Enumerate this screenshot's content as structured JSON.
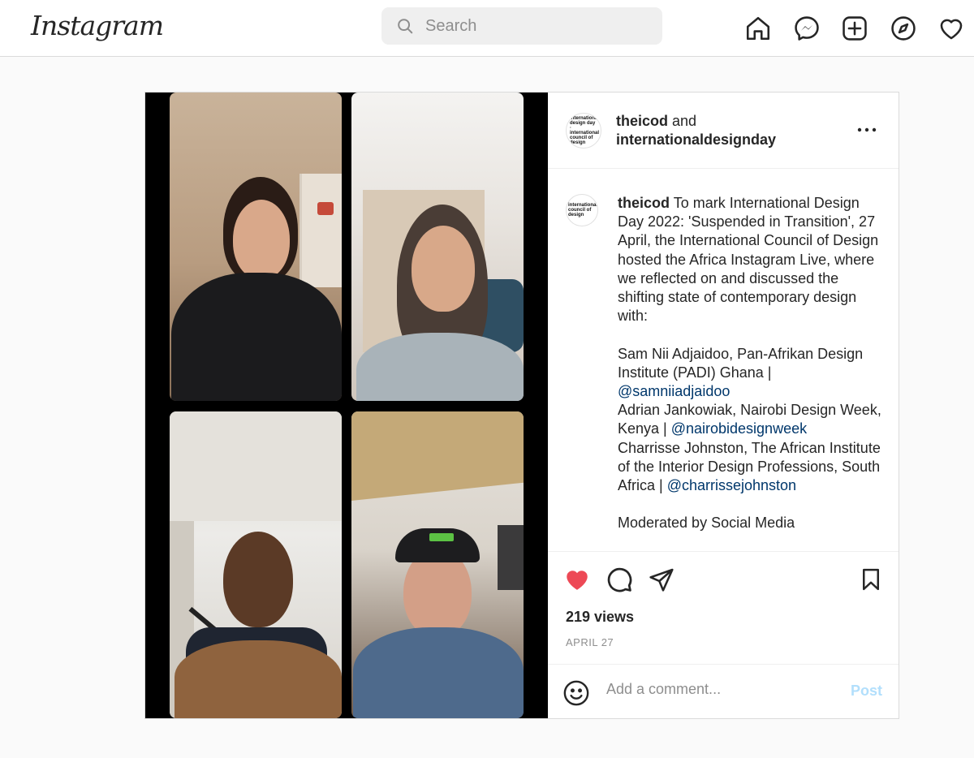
{
  "app": {
    "logo_text": "Instagram"
  },
  "search": {
    "placeholder": "Search",
    "value": ""
  },
  "nav": {
    "icons": [
      "home-icon",
      "messenger-icon",
      "new-post-icon",
      "explore-icon",
      "activity-heart-icon"
    ]
  },
  "post": {
    "header": {
      "author": "theicod",
      "connector": " and",
      "coauthor": "internationaldesignday",
      "avatar_text": "international design day · international council of design"
    },
    "caption": {
      "avatar_text": "international council of design",
      "username": "theicod",
      "intro": " To mark International Design Day 2022: 'Suspended in Transition', 27 April, the International Council of Design hosted the Africa Instagram Live, where we reflected on and discussed the shifting state of contemporary design with:\n\nSam Nii Adjaidoo, Pan-Afrikan Design Institute (PADI) Ghana | ",
      "mention1": "@samniiadjaidoo",
      "text2": "\nAdrian Jankowiak, Nairobi Design Week, Kenya | ",
      "mention2": "@nairobidesignweek",
      "text3": "\nCharrisse Johnston, The African Institute of the Interior Design Professions, South Africa | ",
      "mention3": "@charrissejohnston",
      "text4": "\n\nModerated by Social Media"
    },
    "actions": {
      "liked": true,
      "like_color": "#ed4956"
    },
    "views": "219 views",
    "date": "APRIL 27",
    "comment": {
      "placeholder": "Add a comment...",
      "post_label": "Post",
      "post_color": "#b2dffc"
    }
  }
}
